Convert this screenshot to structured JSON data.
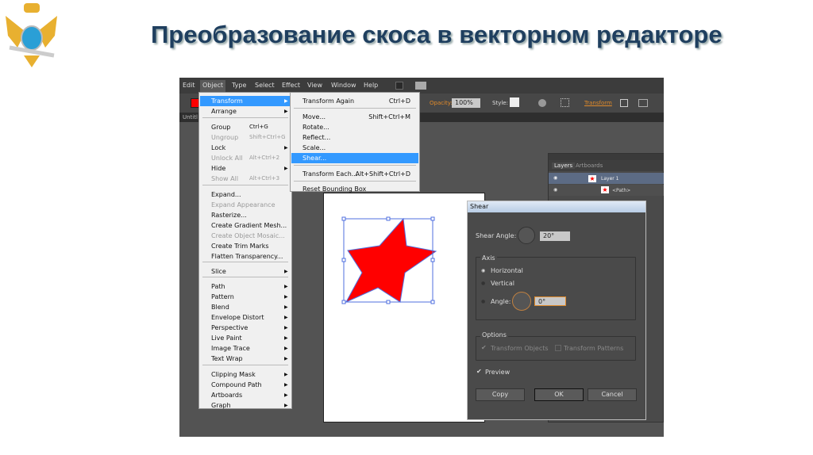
{
  "slide": {
    "title": "Преобразование скоса в векторном редакторе"
  },
  "menubar": {
    "items": [
      "Edit",
      "Object",
      "Type",
      "Select",
      "Effect",
      "View",
      "Window",
      "Help"
    ]
  },
  "control": {
    "opacity_label": "Opacity:",
    "opacity_value": "100%",
    "style_label": "Style:",
    "transform_label": "Transform"
  },
  "tab": {
    "label": "Untitl"
  },
  "object_menu": {
    "items": [
      {
        "label": "Transform",
        "sub": true,
        "highlight": true
      },
      {
        "label": "Arrange",
        "sub": true
      },
      {
        "label": "Group",
        "shortcut": "Ctrl+G"
      },
      {
        "label": "Ungroup",
        "shortcut": "Shift+Ctrl+G",
        "disabled": true
      },
      {
        "label": "Lock",
        "sub": true
      },
      {
        "label": "Unlock All",
        "shortcut": "Alt+Ctrl+2",
        "disabled": true
      },
      {
        "label": "Hide",
        "sub": true
      },
      {
        "label": "Show All",
        "shortcut": "Alt+Ctrl+3",
        "disabled": true
      },
      {
        "label": "Expand..."
      },
      {
        "label": "Expand Appearance",
        "disabled": true
      },
      {
        "label": "Rasterize..."
      },
      {
        "label": "Create Gradient Mesh..."
      },
      {
        "label": "Create Object Mosaic...",
        "disabled": true
      },
      {
        "label": "Create Trim Marks"
      },
      {
        "label": "Flatten Transparency..."
      },
      {
        "label": "Slice",
        "sub": true
      },
      {
        "label": "Path",
        "sub": true
      },
      {
        "label": "Pattern",
        "sub": true
      },
      {
        "label": "Blend",
        "sub": true
      },
      {
        "label": "Envelope Distort",
        "sub": true
      },
      {
        "label": "Perspective",
        "sub": true
      },
      {
        "label": "Live Paint",
        "sub": true
      },
      {
        "label": "Image Trace",
        "sub": true
      },
      {
        "label": "Text Wrap",
        "sub": true
      },
      {
        "label": "Clipping Mask",
        "sub": true
      },
      {
        "label": "Compound Path",
        "sub": true
      },
      {
        "label": "Artboards",
        "sub": true
      },
      {
        "label": "Graph",
        "sub": true
      }
    ]
  },
  "transform_menu": {
    "items": [
      {
        "label": "Transform Again",
        "shortcut": "Ctrl+D"
      },
      {
        "label": "Move...",
        "shortcut": "Shift+Ctrl+M"
      },
      {
        "label": "Rotate..."
      },
      {
        "label": "Reflect..."
      },
      {
        "label": "Scale..."
      },
      {
        "label": "Shear...",
        "highlight": true
      },
      {
        "label": "Transform Each...",
        "shortcut": "Alt+Shift+Ctrl+D"
      },
      {
        "label": "Reset Bounding Box"
      }
    ]
  },
  "layers": {
    "tabs": [
      "Layers",
      "Artboards"
    ],
    "rows": [
      "Layer 1",
      "<Path>"
    ]
  },
  "dialog": {
    "title": "Shear",
    "shear_angle_label": "Shear Angle:",
    "shear_angle_value": "20°",
    "axis_label": "Axis",
    "horizontal": "Horizontal",
    "vertical": "Vertical",
    "angle_label": "Angle:",
    "angle_value": "0°",
    "options_label": "Options",
    "transform_objects": "Transform Objects",
    "transform_patterns": "Transform Patterns",
    "preview": "Preview",
    "copy": "Copy",
    "ok": "OK",
    "cancel": "Cancel",
    "selected_axis": "horizontal",
    "preview_checked": true
  },
  "colors": {
    "fill": "#ff0000",
    "selection": "#4f6fdf",
    "highlight": "#3399ff",
    "title": "#1f3f5f"
  }
}
